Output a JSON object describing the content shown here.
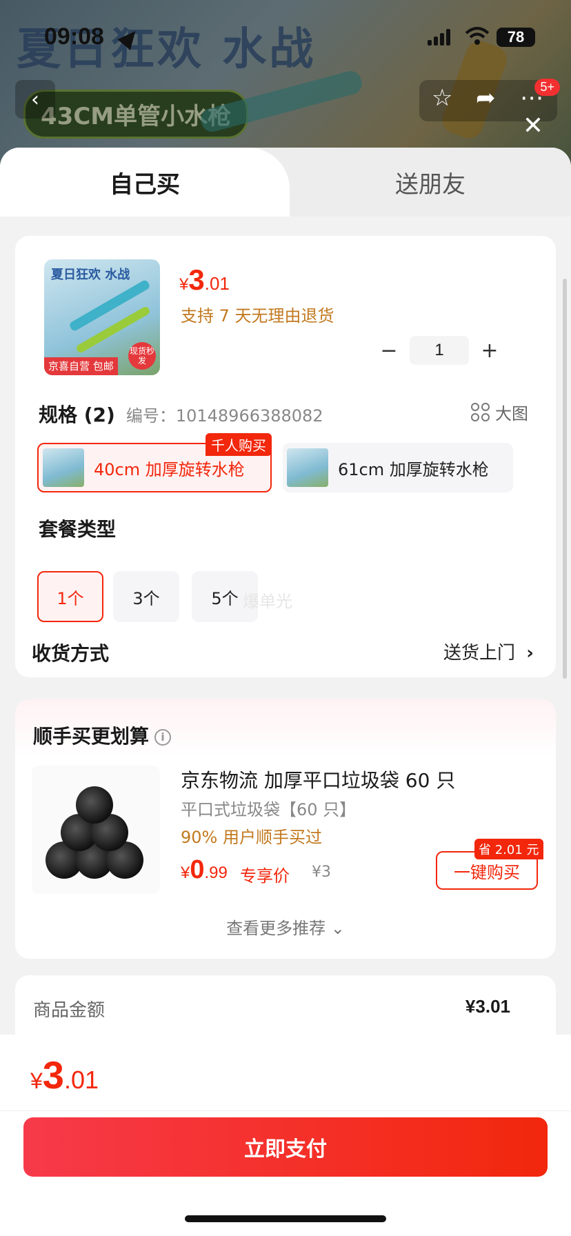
{
  "status": {
    "time": "09:08",
    "battery": "78"
  },
  "header": {
    "banner_text": "夏日狂欢 水战",
    "product_pill": "43CM单管小水枪",
    "badge": "5+"
  },
  "tabs": [
    {
      "label": "自己买"
    },
    {
      "label": "送朋友"
    }
  ],
  "product": {
    "thumb_title": "夏日狂欢 水战",
    "thumb_tag": "京喜自营 包邮",
    "thumb_stamp": "现货秒发",
    "price_currency": "¥",
    "price_int": "3",
    "price_dec": ".01",
    "return_policy": "支持 7 天无理由退货",
    "quantity": "1"
  },
  "spec": {
    "title": "规格 (2)",
    "code": "编号：10148966388082",
    "big_image": "大图",
    "hot_tag": "千人购买",
    "options": [
      {
        "label": "40cm 加厚旋转水枪"
      },
      {
        "label": "61cm 加厚旋转水枪"
      }
    ]
  },
  "combo": {
    "title": "套餐类型",
    "options": [
      {
        "label": "1个"
      },
      {
        "label": "3个"
      },
      {
        "label": "5个"
      }
    ],
    "watermark": "爆单光"
  },
  "delivery": {
    "label": "收货方式",
    "value": "送货上门"
  },
  "recommend": {
    "title": "顺手买更划算",
    "name": "京东物流 加厚平口垃圾袋 60 只",
    "sub": "平口式垃圾袋【60 只】",
    "percent": "90% 用户顺手买过",
    "price_currency": "¥",
    "price_int": "0",
    "price_dec": ".99",
    "exclusive": "专享价",
    "orig_price": "¥3",
    "save_tag": "省 2.01 元",
    "buy_label": "一键购买",
    "more": "查看更多推荐"
  },
  "summary": {
    "label": "商品金额",
    "value": "¥3.01"
  },
  "footer": {
    "price_currency": "¥",
    "price_int": "3",
    "price_dec": ".01",
    "pay_label": "立即支付"
  },
  "colors": {
    "accent": "#f2270c",
    "gold": "#c2791f"
  }
}
